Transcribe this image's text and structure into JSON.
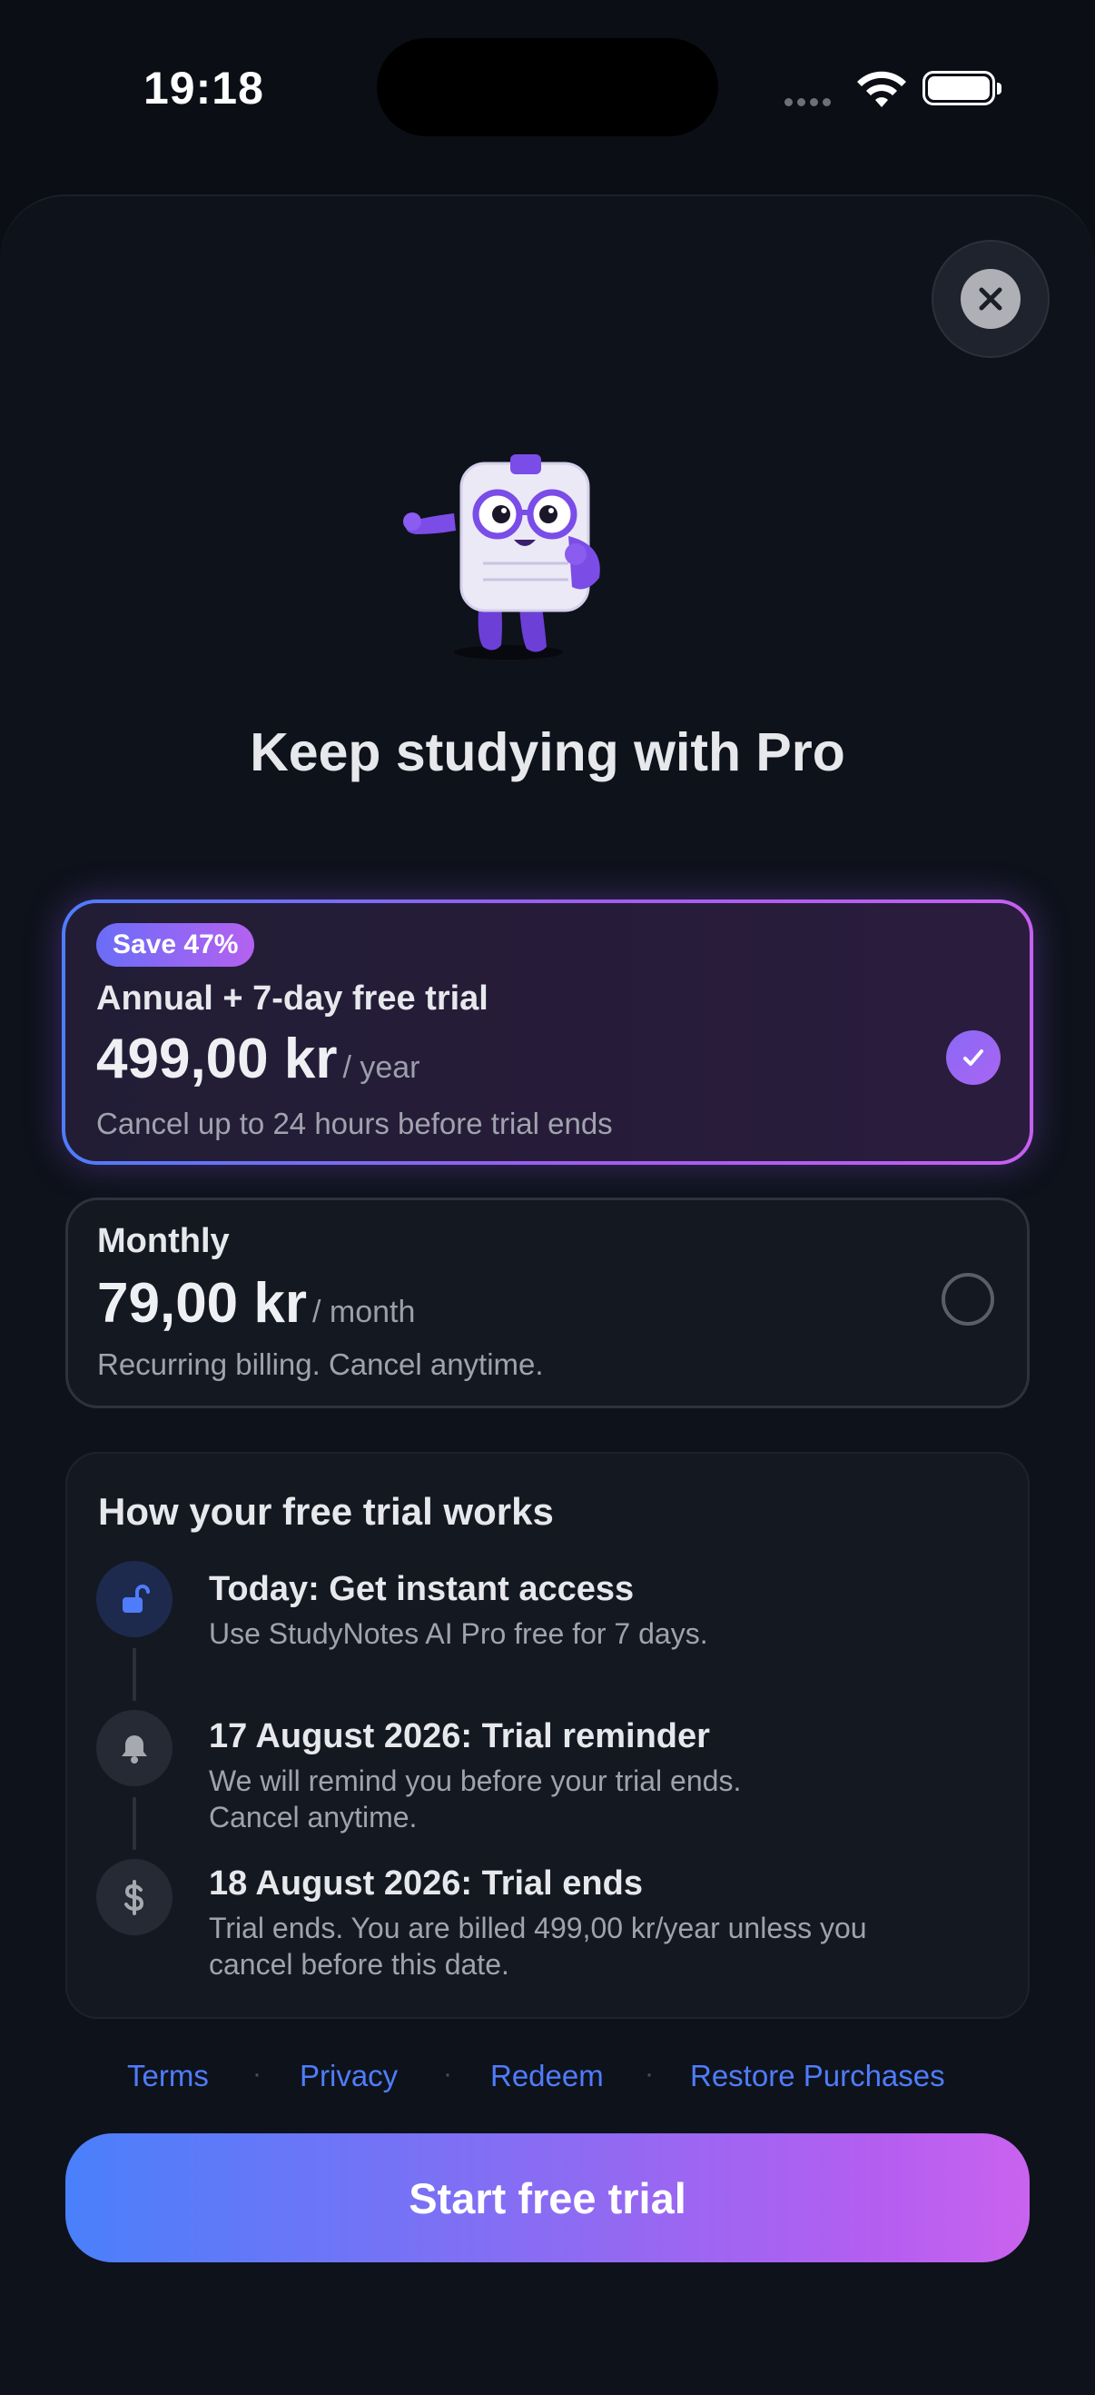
{
  "status": {
    "time": "19:18"
  },
  "headline": "Keep studying with Pro",
  "plans": [
    {
      "badge": "Save 47%",
      "name": "Annual + 7-day free trial",
      "price": "499,00 kr",
      "period": "/ year",
      "note": "Cancel up to 24 hours before trial ends",
      "selected": true
    },
    {
      "name": "Monthly",
      "price": "79,00 kr",
      "period": "/ month",
      "note": "Recurring billing. Cancel anytime.",
      "selected": false
    }
  ],
  "trial": {
    "title": "How your free trial works",
    "steps": [
      {
        "icon": "unlock-icon",
        "title": "Today: Get instant access",
        "desc": "Use StudyNotes AI Pro free for 7 days."
      },
      {
        "icon": "bell-icon",
        "title": "17 August 2026: Trial reminder",
        "desc": "We will remind you before your trial ends.\nCancel anytime."
      },
      {
        "icon": "dollar-icon",
        "title": "18 August 2026: Trial ends",
        "desc": "Trial ends. You are billed 499,00 kr/year unless you\ncancel before this date."
      }
    ]
  },
  "links": {
    "terms": "Terms",
    "privacy": "Privacy",
    "redeem": "Redeem",
    "restore": "Restore Purchases",
    "separator": "·"
  },
  "cta": "Start free trial",
  "colors": {
    "accent_blue": "#4f7cfb",
    "accent_purple": "#b55ef0",
    "background": "#0b0e15"
  }
}
